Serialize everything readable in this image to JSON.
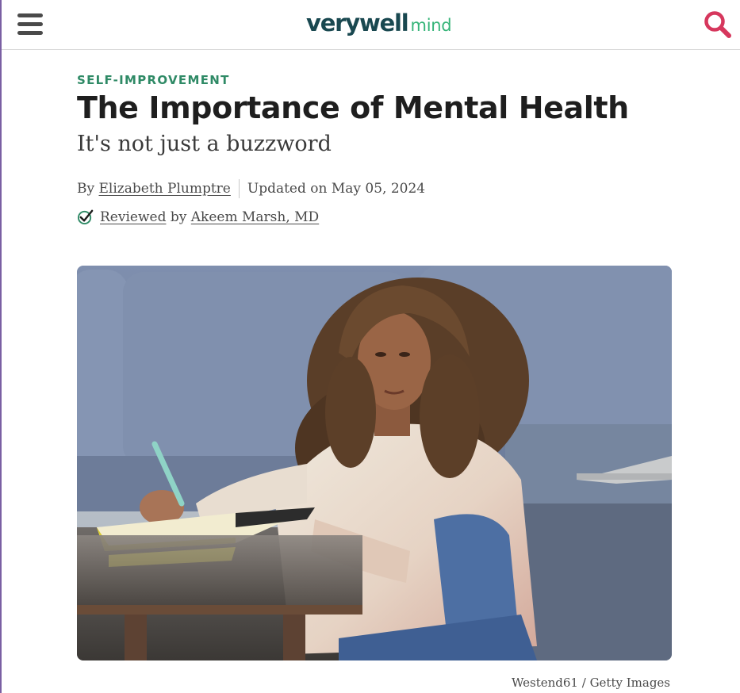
{
  "header": {
    "logo_main": "verywell",
    "logo_sub": "mind",
    "menu_icon": "hamburger-menu-icon",
    "search_icon": "search-icon",
    "accent_color": "#d6375d"
  },
  "article": {
    "category": "SELF-IMPROVEMENT",
    "title": "The Importance of Mental Health",
    "subtitle": "It's not just a buzzword",
    "byline": {
      "by": "By",
      "author": "Elizabeth Plumptre",
      "updated": "Updated on May 05, 2024"
    },
    "review": {
      "reviewed_link": "Reviewed",
      "by": "by",
      "reviewer": "Akeem Marsh, MD",
      "check_icon": "checkmark-icon"
    },
    "image_credit": "Westend61 / Getty Images"
  }
}
